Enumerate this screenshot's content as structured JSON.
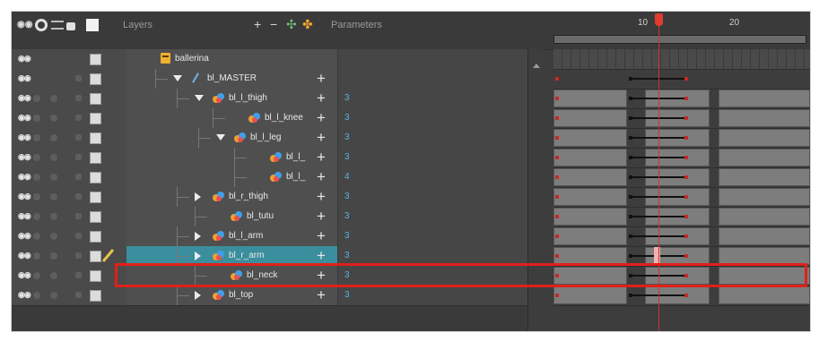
{
  "header": {
    "layers_label": "Layers",
    "parameters_label": "Parameters"
  },
  "timeline": {
    "frame_numbers": [
      "10",
      "20"
    ],
    "current_frame": 12
  },
  "layers": [
    {
      "name": "ballerina",
      "param": "",
      "type": "drawing",
      "expand": "none",
      "selected": false
    },
    {
      "name": "bl_MASTER",
      "param": "",
      "type": "master",
      "expand": "open",
      "selected": false
    },
    {
      "name": "bl_l_thigh",
      "param": "3",
      "type": "peg",
      "expand": "open",
      "selected": false
    },
    {
      "name": "bl_l_knee",
      "param": "3",
      "type": "peg",
      "expand": "none",
      "selected": false
    },
    {
      "name": "bl_l_leg",
      "param": "3",
      "type": "peg",
      "expand": "open",
      "selected": false
    },
    {
      "name": "bl_l_",
      "param": "3",
      "type": "peg",
      "expand": "none",
      "selected": false
    },
    {
      "name": "bl_l_",
      "param": "4",
      "type": "peg",
      "expand": "none",
      "selected": false
    },
    {
      "name": "bl_r_thigh",
      "param": "3",
      "type": "peg",
      "expand": "closed",
      "selected": false
    },
    {
      "name": "bl_tutu",
      "param": "3",
      "type": "peg",
      "expand": "none",
      "selected": false
    },
    {
      "name": "bl_l_arm",
      "param": "3",
      "type": "peg",
      "expand": "closed",
      "selected": false
    },
    {
      "name": "bl_r_arm",
      "param": "3",
      "type": "peg",
      "expand": "closed",
      "selected": true
    },
    {
      "name": "bl_neck",
      "param": "3",
      "type": "peg",
      "expand": "none",
      "selected": false
    },
    {
      "name": "bl_top",
      "param": "3",
      "type": "peg",
      "expand": "closed",
      "selected": false
    }
  ],
  "colors": {
    "selection": "#3b8e9d",
    "highlight_box": "#e0201a",
    "playhead": "#e03c2e",
    "param_value": "#56b4e0"
  }
}
